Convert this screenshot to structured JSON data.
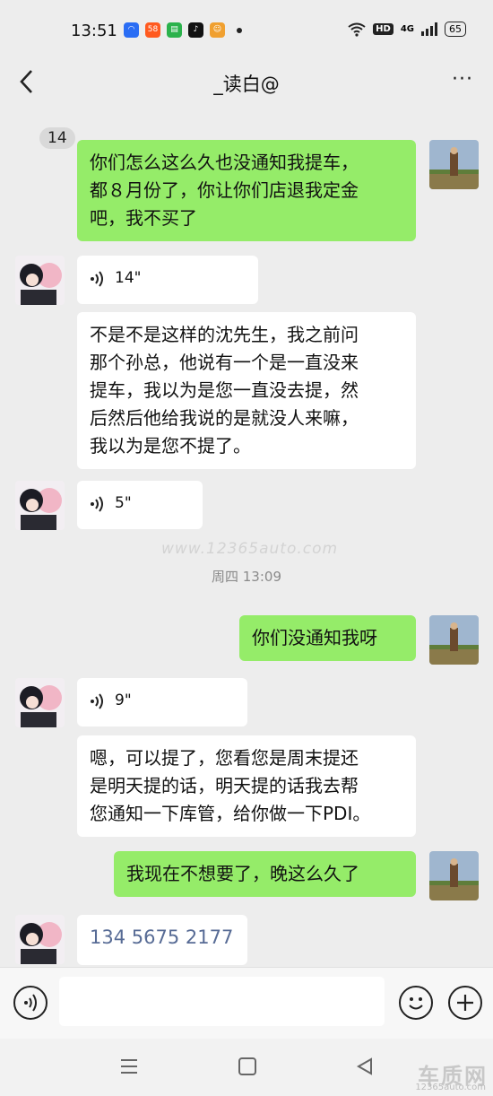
{
  "status_bar": {
    "time": "13:51",
    "notif_icons": [
      {
        "name": "app-icon-1",
        "color": "#2a6df4",
        "glyph": "◠"
      },
      {
        "name": "58-icon",
        "color": "#ff5a1f",
        "glyph": "58"
      },
      {
        "name": "message-app-icon",
        "color": "#2bb24c",
        "glyph": "▤"
      },
      {
        "name": "tiktok-icon",
        "color": "#111111",
        "glyph": "♪"
      },
      {
        "name": "mascot-app-icon",
        "color": "#f0a030",
        "glyph": "☺"
      }
    ],
    "hd_label": "HD",
    "signal_label": "4G",
    "battery": "65"
  },
  "nav": {
    "unread_count": "14",
    "contact_name": "_读白@",
    "more": "···"
  },
  "messages": [
    {
      "from": "me",
      "type": "text",
      "text_lines": [
        "你们怎么这么久也没通知我提车，",
        "都８月份了，你让你们店退我定金",
        "吧，我不买了"
      ]
    },
    {
      "from": "them",
      "type": "voice",
      "duration": "14\""
    },
    {
      "from": "them",
      "type": "text",
      "text_lines": [
        "不是不是这样的沈先生，我之前问",
        "那个孙总，他说有一个是一直没来",
        "提车，我以为是您一直没去提，然",
        "后然后他给我说的是就没人来嘛，",
        "我以为是您不提了。"
      ]
    },
    {
      "from": "them",
      "type": "voice",
      "duration": "5\""
    },
    {
      "from": "system",
      "type": "time",
      "text": "周四 13:09"
    },
    {
      "from": "me",
      "type": "text",
      "text_lines": [
        "你们没通知我呀"
      ]
    },
    {
      "from": "them",
      "type": "voice",
      "duration": "9\""
    },
    {
      "from": "them",
      "type": "text",
      "text_lines": [
        "嗯，可以提了，您看您是周末提还",
        "是明天提的话，明天提的话我去帮",
        "您通知一下库管，给你做一下PDI。"
      ]
    },
    {
      "from": "me",
      "type": "text",
      "text_lines": [
        "我现在不想要了，晚这么久了"
      ]
    },
    {
      "from": "them",
      "type": "link",
      "text": "134 5675 2177"
    }
  ],
  "watermark": "www.12365auto.com",
  "corner_logo": "车质网",
  "corner_url": "12365auto.com",
  "colors": {
    "me_bubble": "#95ec69",
    "them_bubble": "#ffffff",
    "bg": "#ededed",
    "link": "#576b95"
  }
}
